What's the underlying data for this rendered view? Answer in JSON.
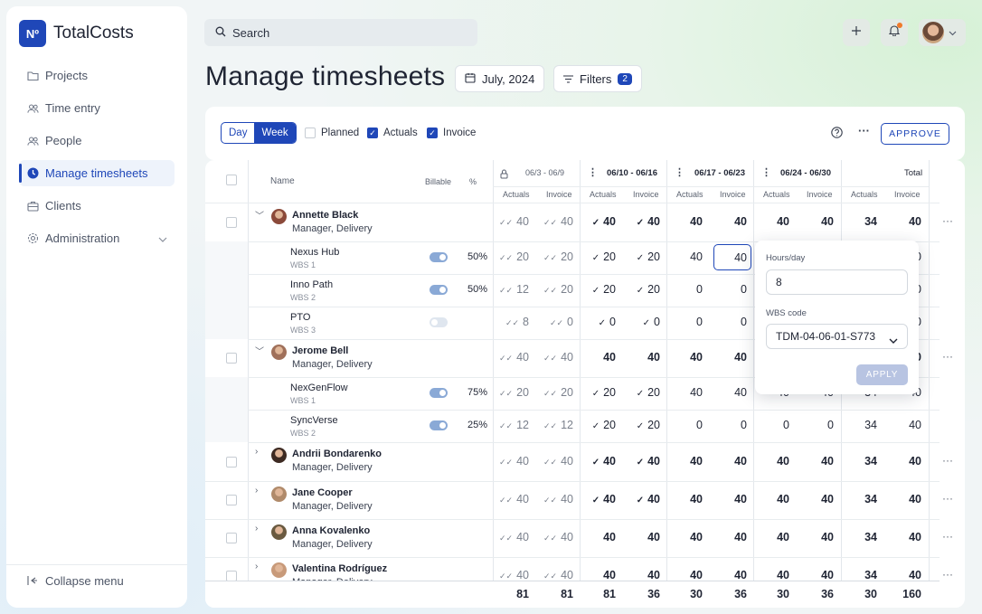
{
  "app": {
    "logo_badge": "Nº",
    "name": "TotalCosts"
  },
  "sidebar": {
    "items": [
      {
        "label": "Projects",
        "icon": "folder-icon"
      },
      {
        "label": "Time entry",
        "icon": "users-icon"
      },
      {
        "label": "People",
        "icon": "people-icon"
      },
      {
        "label": "Manage timesheets",
        "icon": "clock-icon",
        "active": true
      },
      {
        "label": "Clients",
        "icon": "briefcase-icon"
      },
      {
        "label": "Administration",
        "icon": "gear-icon",
        "expandable": true
      }
    ],
    "collapse_label": "Collapse menu"
  },
  "header": {
    "search_placeholder": "Search",
    "notification_dot_color": "#f07a2a"
  },
  "page": {
    "title": "Manage timesheets",
    "date_label": "July, 2024",
    "filters_label": "Filters",
    "filters_count": "2"
  },
  "toolbar": {
    "view_day": "Day",
    "view_week": "Week",
    "active_view": "Week",
    "planned_label": "Planned",
    "planned_checked": false,
    "actuals_label": "Actuals",
    "actuals_checked": true,
    "invoice_label": "Invoice",
    "invoice_checked": true,
    "approve_label": "APPROVE"
  },
  "table": {
    "headers": {
      "name": "Name",
      "billable": "Billable",
      "percent": "%",
      "actuals": "Actuals",
      "invoice": "Invoice",
      "total": "Total"
    },
    "weeks": [
      "06/3 - 06/9",
      "06/10 - 06/16",
      "06/17 - 06/23",
      "06/24 - 06/30"
    ],
    "rows": [
      {
        "type": "person",
        "name": "Annette Black",
        "role": "Manager, Delivery",
        "expanded": true,
        "values": [
          "40",
          "40",
          "40",
          "40",
          "40",
          "40",
          "40",
          "40",
          "34",
          "40"
        ]
      },
      {
        "type": "project",
        "name": "Nexus Hub",
        "wbs": "WBS 1",
        "billable": true,
        "pct": "50%",
        "values": [
          "20",
          "20",
          "20",
          "20",
          "40",
          "40",
          "",
          "",
          "",
          "0"
        ]
      },
      {
        "type": "project",
        "name": "Inno Path",
        "wbs": "WBS 2",
        "billable": true,
        "pct": "50%",
        "values": [
          "12",
          "20",
          "20",
          "20",
          "0",
          "0",
          "",
          "",
          "",
          "0"
        ]
      },
      {
        "type": "project",
        "name": "PTO",
        "wbs": "WBS 3",
        "billable": false,
        "pct": "",
        "values": [
          "8",
          "0",
          "0",
          "0",
          "0",
          "0",
          "",
          "",
          "",
          "0"
        ]
      },
      {
        "type": "person",
        "name": "Jerome Bell",
        "role": "Manager, Delivery",
        "expanded": true,
        "values": [
          "40",
          "40",
          "40",
          "40",
          "40",
          "40",
          "",
          "",
          "",
          "0"
        ]
      },
      {
        "type": "project",
        "name": "NexGenFlow",
        "wbs": "WBS 1",
        "billable": true,
        "pct": "75%",
        "values": [
          "20",
          "20",
          "20",
          "20",
          "40",
          "40",
          "40",
          "40",
          "34",
          "40"
        ]
      },
      {
        "type": "project",
        "name": "SyncVerse",
        "wbs": "WBS 2",
        "billable": true,
        "pct": "25%",
        "values": [
          "12",
          "12",
          "20",
          "20",
          "0",
          "0",
          "0",
          "0",
          "34",
          "40"
        ]
      },
      {
        "type": "person",
        "name": "Andrii Bondarenko",
        "role": "Manager, Delivery",
        "expanded": false,
        "values": [
          "40",
          "40",
          "40",
          "40",
          "40",
          "40",
          "40",
          "40",
          "34",
          "40"
        ]
      },
      {
        "type": "person",
        "name": "Jane Cooper",
        "role": "Manager, Delivery",
        "expanded": false,
        "values": [
          "40",
          "40",
          "40",
          "40",
          "40",
          "40",
          "40",
          "40",
          "34",
          "40"
        ]
      },
      {
        "type": "person",
        "name": "Anna Kovalenko",
        "role": "Manager, Delivery",
        "expanded": false,
        "values": [
          "40",
          "40",
          "40",
          "40",
          "40",
          "40",
          "40",
          "40",
          "34",
          "40"
        ]
      },
      {
        "type": "person",
        "name": "Valentina Rodríguez",
        "role": "Manager, Delivery",
        "expanded": false,
        "values": [
          "40",
          "40",
          "40",
          "40",
          "40",
          "40",
          "40",
          "40",
          "34",
          "40"
        ]
      }
    ],
    "totals": [
      "81",
      "81",
      "81",
      "36",
      "30",
      "36",
      "30",
      "36",
      "30",
      "160"
    ]
  },
  "popup": {
    "hours_label": "Hours/day",
    "hours_value": "8",
    "wbs_label": "WBS code",
    "wbs_value": "TDM-04-06-01-S773",
    "apply_label": "APPLY",
    "cell_value": "40"
  }
}
